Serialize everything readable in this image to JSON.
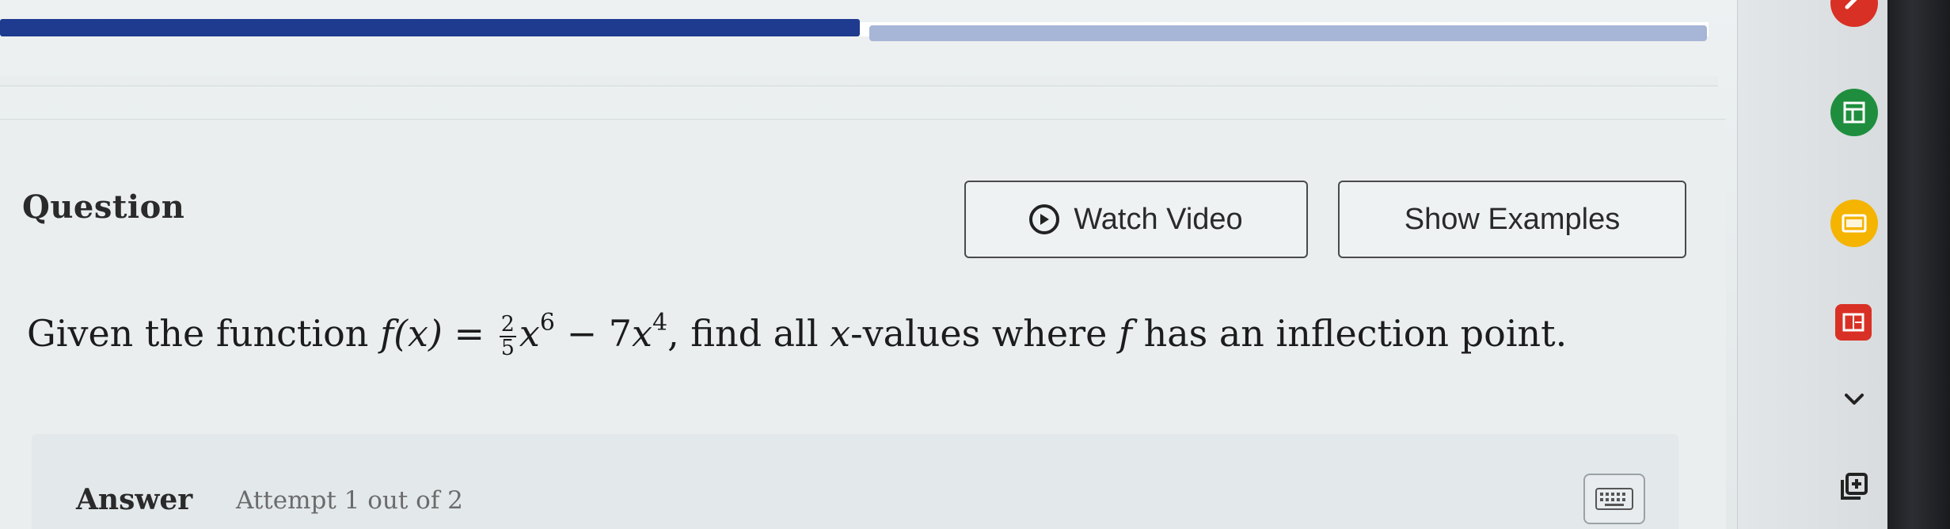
{
  "progress": {
    "completed_fraction": 0.5
  },
  "question": {
    "label": "Question",
    "prefix": "Given the function ",
    "function_name": "f(x) = ",
    "frac_num": "2",
    "frac_den": "5",
    "term1_var": "x",
    "term1_exp": "6",
    "minus": " − 7",
    "term2_var": "x",
    "term2_exp": "4",
    "suffix_a": ", find all ",
    "x_var": "x",
    "suffix_b": "-values where ",
    "f_var": "f",
    "suffix_c": " has an inflection point."
  },
  "buttons": {
    "watch_video": "Watch Video",
    "show_examples": "Show Examples"
  },
  "answer": {
    "label": "Answer",
    "attempt": "Attempt 1 out of 2"
  },
  "dock": {
    "icons": [
      "app-icon-red",
      "sheets-icon",
      "slides-icon",
      "forms-icon",
      "chevron-down-icon",
      "add-box-icon"
    ]
  },
  "colors": {
    "progress_fill": "#1f3b8f",
    "progress_rest": "#a7b5d6",
    "sheets_green": "#1e8e3e",
    "slides_yellow": "#f4b400",
    "forms_red": "#d93025"
  }
}
